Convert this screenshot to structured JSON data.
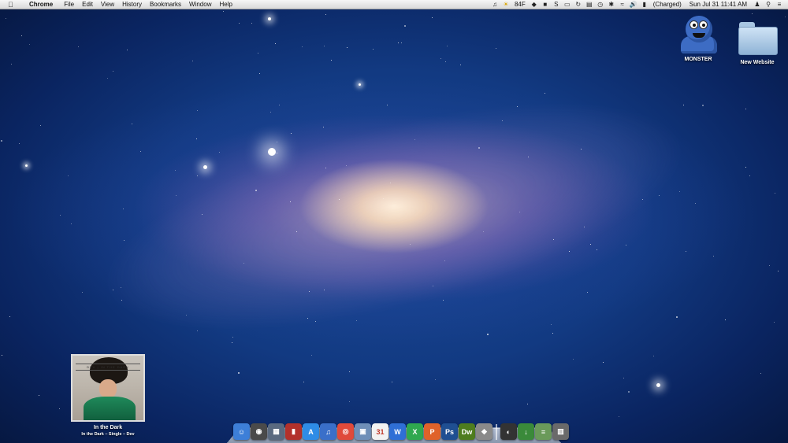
{
  "menubar": {
    "apple_icon": "apple-icon",
    "app_name": "Chrome",
    "menus": [
      "File",
      "Edit",
      "View",
      "History",
      "Bookmarks",
      "Window",
      "Help"
    ],
    "status": {
      "weather": "84F",
      "battery": "(Charged)",
      "datetime": "Sun Jul 31  11:41 AM"
    }
  },
  "desktop": {
    "icons": [
      {
        "label": "MONSTER",
        "icon": "cookie-monster-icon"
      },
      {
        "label": "New Website",
        "icon": "folder-icon"
      }
    ]
  },
  "now_playing": {
    "cover_text": "DEV | IN THE DARK",
    "track": "In the Dark",
    "details": "In the Dark – Single – Dev"
  },
  "dock": {
    "apps": [
      {
        "name": "finder-icon",
        "glyph": "☺",
        "color": "#3d7fd8"
      },
      {
        "name": "dashboard-icon",
        "glyph": "◉",
        "color": "#4a4a4a"
      },
      {
        "name": "mission-control-icon",
        "glyph": "▦",
        "color": "#5a6a80"
      },
      {
        "name": "photo-booth-icon",
        "glyph": "▮",
        "color": "#b3312b"
      },
      {
        "name": "app-store-icon",
        "glyph": "A",
        "color": "#2e8ce6"
      },
      {
        "name": "itunes-icon",
        "glyph": "♫",
        "color": "#3a6fc9"
      },
      {
        "name": "chrome-icon",
        "glyph": "◎",
        "color": "#e04a3a"
      },
      {
        "name": "preview-icon",
        "glyph": "▣",
        "color": "#6f8fb8"
      },
      {
        "name": "calendar-icon",
        "glyph": "31",
        "color": "#f2f2f2"
      },
      {
        "name": "word-icon",
        "glyph": "W",
        "color": "#2f6fd6"
      },
      {
        "name": "excel-icon",
        "glyph": "X",
        "color": "#2fa84f"
      },
      {
        "name": "powerpoint-icon",
        "glyph": "P",
        "color": "#e0622a"
      },
      {
        "name": "photoshop-icon",
        "glyph": "Ps",
        "color": "#1f4f92"
      },
      {
        "name": "dreamweaver-icon",
        "glyph": "Dw",
        "color": "#4e7d1e"
      },
      {
        "name": "sequel-icon",
        "glyph": "◆",
        "color": "#8a8a8a"
      },
      {
        "name": "firefox-folder-icon",
        "glyph": "◐",
        "color": "#333333"
      },
      {
        "name": "downloads-icon",
        "glyph": "↓",
        "color": "#3a8a3a"
      },
      {
        "name": "documents-icon",
        "glyph": "≡",
        "color": "#6a9a5a"
      },
      {
        "name": "trash-icon",
        "glyph": "▥",
        "color": "#6a6a6a"
      }
    ]
  }
}
